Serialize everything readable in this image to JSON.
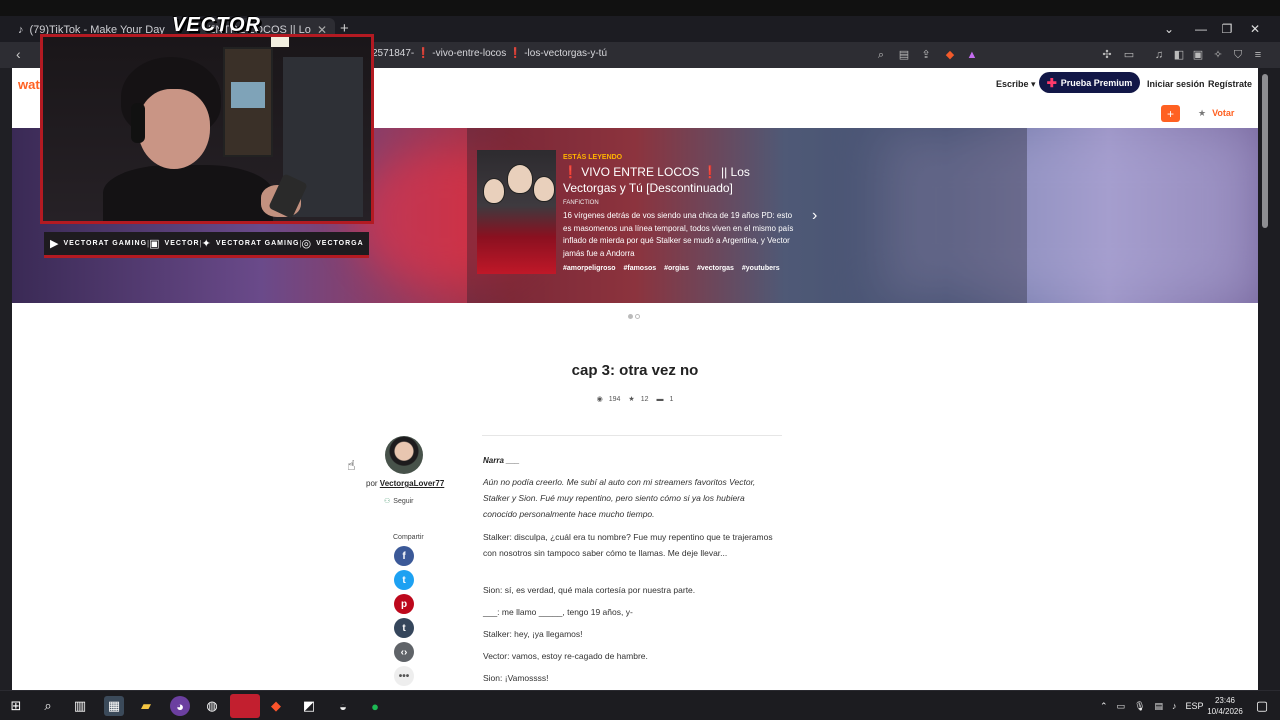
{
  "browser": {
    "tabs": [
      {
        "label": "(79)TikTok - Make Your Day"
      },
      {
        "label": "ENTRE LOCOS  || Lo"
      }
    ],
    "new_tab": "+",
    "url_parts": [
      "2571847-",
      "-vivo-entre-locos",
      "-los-vectorgas-y-tú"
    ]
  },
  "header": {
    "logo": "watt",
    "escribe": "Escribe",
    "premium": "Prueba Premium",
    "login": "Iniciar sesión",
    "register": "Regístrate",
    "add": "+",
    "vote": "Votar"
  },
  "hero": {
    "reading_label": "ESTÁS LEYENDO",
    "story_title_a": "VIVO ENTRE LOCOS",
    "story_title_b": "|| Los Vectorgas y Tú [Descontinuado]",
    "category": "FANFICTION",
    "description": "16 vírgenes detrás de vos siendo una chica de 19 años PD: esto es masomenos una línea temporal, todos viven en el mismo país inflado de mierda por qué Stalker se mudó a Argentina, y Vector jamás fue a Andorra",
    "tags": [
      "#amorpeligroso",
      "#famosos",
      "#orgias",
      "#vectorgas",
      "#youtubers"
    ]
  },
  "chapter": {
    "title": "cap 3: otra vez no",
    "views": "194",
    "votes": "12",
    "comments": "1"
  },
  "author": {
    "by": "por",
    "name": "VectorgaLover77",
    "follow": "Seguir",
    "share": "Compartir"
  },
  "story": {
    "narra": "Narra ___",
    "paragraphs": [
      "Aún no podía creerlo. Me subí al auto con mi streamers favoritos Vector, Stalker y Sion. Fué muy repentino, pero siento cómo si ya los hubiera conocido personalmente hace mucho tiempo.",
      "Stalker: disculpa, ¿cuál era tu nombre? Fue muy repentino que te trajeramos con nosotros sin tampoco saber cómo te llamas. Me deje llevar...",
      "Sion: sí, es verdad, qué mala cortesía por nuestra parte.",
      "___: me llamo _____, tengo 19 años, y-",
      "Stalker: hey, ¡ya llegamos!",
      "Vector: vamos, estoy re-cagado de hambre.",
      "Sion: ¡Vamossss!"
    ]
  },
  "stream_overlay": {
    "logo": "VECTOR",
    "socials": [
      {
        "icon": "youtube-icon",
        "label": "VECTORAT GAMING"
      },
      {
        "icon": "twitch-icon",
        "label": "VECTOR"
      },
      {
        "icon": "twitter-icon",
        "label": "VECTORAT GAMING"
      },
      {
        "icon": "instagram-icon",
        "label": "VECTORGA"
      }
    ]
  },
  "taskbar": {
    "lang": "ESP",
    "time": "23:46",
    "date": "10/4/2026"
  },
  "colors": {
    "accent": "#ff6122",
    "premium_bg": "#121747",
    "overlay_red": "#b31a22"
  }
}
